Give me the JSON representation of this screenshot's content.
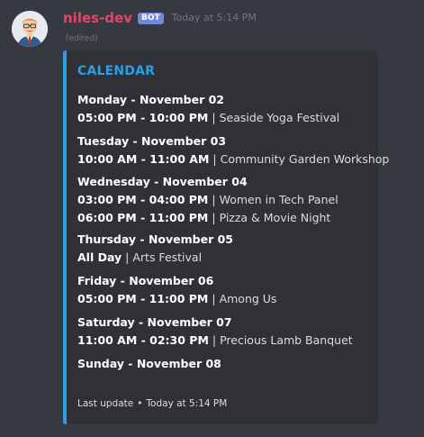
{
  "message": {
    "username": "niles-dev",
    "bot_tag": "BOT",
    "timestamp": "Today at 5:14 PM",
    "edited": "(edited)"
  },
  "colors": {
    "username": "#e9436b",
    "bot_tag": "#7289da",
    "embed_accent": "#2a9fe3",
    "background": "#36393f",
    "embed_background": "#2f3136"
  },
  "embed": {
    "title": "CALENDAR",
    "days": [
      {
        "title": "Monday - November 02",
        "events": [
          {
            "time": "05:00 PM - 10:00 PM",
            "name": "Seaside Yoga Festival"
          }
        ]
      },
      {
        "title": "Tuesday - November 03",
        "events": [
          {
            "time": "10:00 AM - 11:00 AM",
            "name": "Community Garden Workshop"
          }
        ]
      },
      {
        "title": "Wednesday - November 04",
        "events": [
          {
            "time": "03:00 PM - 04:00 PM",
            "name": "Women in Tech Panel"
          },
          {
            "time": "06:00 PM - 11:00 PM",
            "name": "Pizza & Movie Night"
          }
        ]
      },
      {
        "title": "Thursday - November 05",
        "events": [
          {
            "time": "All Day",
            "name": "Arts Festival"
          }
        ]
      },
      {
        "title": "Friday - November 06",
        "events": [
          {
            "time": "05:00 PM - 11:00 PM",
            "name": "Among Us"
          }
        ]
      },
      {
        "title": "Saturday - November 07",
        "events": [
          {
            "time": "11:00 AM - 02:30 PM",
            "name": "Precious Lamb Banquet"
          }
        ]
      },
      {
        "title": "Sunday - November 08",
        "events": []
      }
    ],
    "footer": {
      "label": "Last update",
      "separator": "•",
      "timestamp": "Today at 5:14 PM"
    },
    "event_separator": "|"
  },
  "icons": {
    "avatar": "user-avatar-icon"
  }
}
